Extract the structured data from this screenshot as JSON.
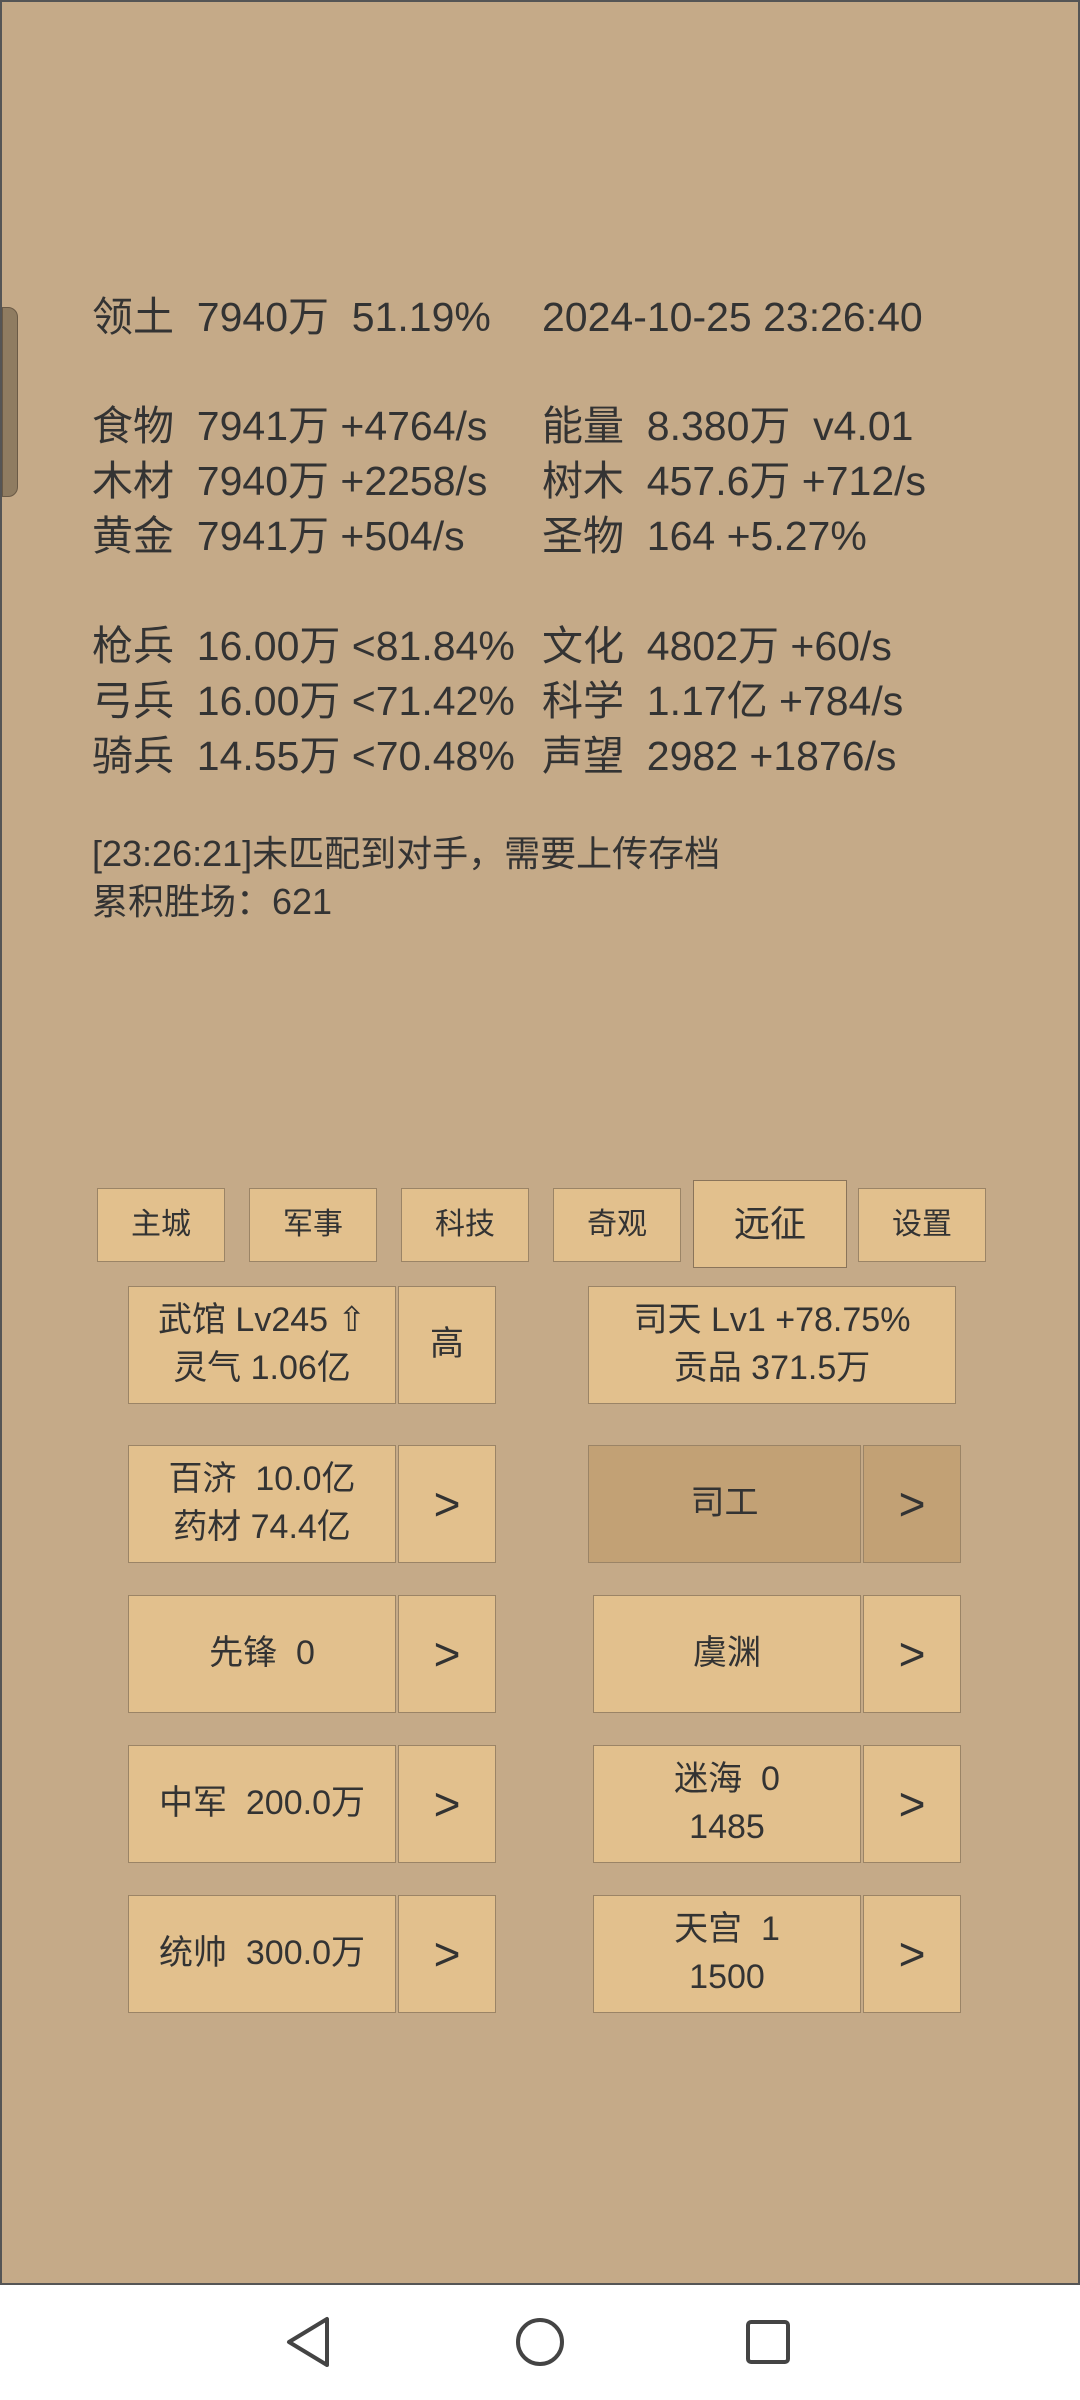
{
  "stats": {
    "territory": "领土  7940万  51.19%",
    "datetime": "2024-10-25 23:26:40",
    "food": "食物  7941万 +4764/s",
    "energy": "能量  8.380万  v4.01",
    "wood": "木材  7940万 +2258/s",
    "trees": "树木  457.6万 +712/s",
    "gold": "黄金  7941万 +504/s",
    "relics": "圣物  164 +5.27%",
    "spearmen": "枪兵  16.00万 <81.84%",
    "culture": "文化  4802万 +60/s",
    "archers": "弓兵  16.00万 <71.42%",
    "science": "科学  1.17亿 +784/s",
    "cavalry": "骑兵  14.55万 <70.48%",
    "prestige": "声望  2982 +1876/s"
  },
  "messages": {
    "log": "[23:26:21]未匹配到对手，需要上传存档",
    "wins": "累积胜场：621"
  },
  "tabs": [
    {
      "label": "主城"
    },
    {
      "label": "军事"
    },
    {
      "label": "科技"
    },
    {
      "label": "奇观"
    },
    {
      "label": "远征"
    },
    {
      "label": "设置"
    }
  ],
  "panel": {
    "wuguan_line1": "武馆 Lv245 ⇧",
    "wuguan_line2": "灵气 1.06亿",
    "high_label": "高",
    "sitian_line1": "司天 Lv1 +78.75%",
    "sitian_line2": "贡品 371.5万",
    "baiji_line1": "百济  10.0亿",
    "baiji_line2": "药材 74.4亿",
    "sigong_label": "司工",
    "xianfeng_label": "先锋  0",
    "yuyuan_label": "虞渊",
    "zhongjun_label": "中军  200.0万",
    "mihai_line1": "迷海  0",
    "mihai_line2": "1485",
    "tongshuai_label": "统帅  300.0万",
    "tiangong_line1": "天宫  1",
    "tiangong_line2": "1500",
    "arrow": ">"
  },
  "colors": {
    "background": "#c5aa88",
    "button": "#e2c08d",
    "button_dark": "#c2a175"
  },
  "navbar": {
    "icons": [
      "back-triangle-icon",
      "home-circle-icon",
      "recents-square-icon"
    ]
  }
}
